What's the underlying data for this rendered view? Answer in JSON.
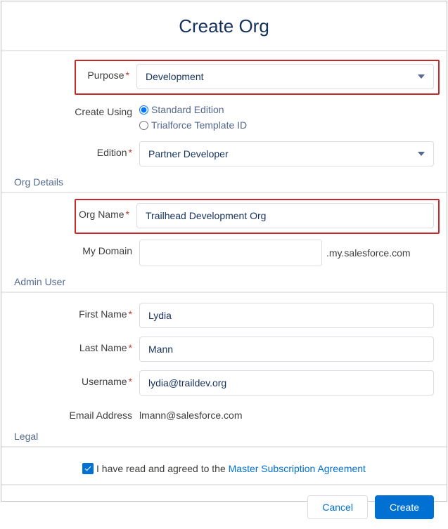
{
  "header": {
    "title": "Create Org"
  },
  "fields": {
    "purpose": {
      "label": "Purpose",
      "value": "Development"
    },
    "createUsing": {
      "label": "Create Using",
      "opt1": "Standard Edition",
      "opt2": "Trialforce Template ID"
    },
    "edition": {
      "label": "Edition",
      "value": "Partner Developer"
    },
    "orgName": {
      "label": "Org Name",
      "value": "Trailhead Development Org"
    },
    "myDomain": {
      "label": "My Domain",
      "value": "",
      "suffix": ".my.salesforce.com"
    },
    "firstName": {
      "label": "First Name",
      "value": "Lydia"
    },
    "lastName": {
      "label": "Last Name",
      "value": "Mann"
    },
    "username": {
      "label": "Username",
      "value": "lydia@traildev.org"
    },
    "email": {
      "label": "Email Address",
      "value": "lmann@salesforce.com"
    }
  },
  "sections": {
    "orgDetails": "Org Details",
    "adminUser": "Admin User",
    "legal": "Legal"
  },
  "legal": {
    "text": "I have read and agreed to the ",
    "link": "Master Subscription Agreement"
  },
  "buttons": {
    "cancel": "Cancel",
    "create": "Create"
  }
}
